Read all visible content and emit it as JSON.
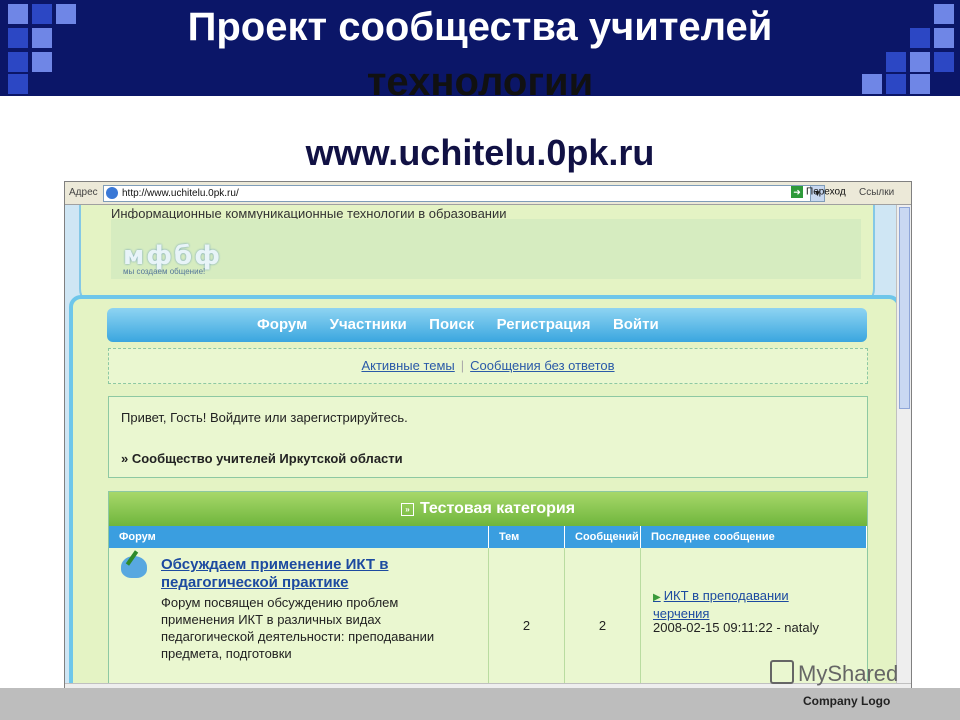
{
  "slide": {
    "title_line1": "Проект сообщества учителей",
    "title_line2": "технологии",
    "url": "www.uchitelu.0pk.ru"
  },
  "browser": {
    "address_label": "Адрес",
    "address_value": "http://www.uchitelu.0pk.ru/",
    "go_label": "Переход",
    "links_label": "Ссылки"
  },
  "site": {
    "slogan": "Информационные коммуникационные технологии в образовании",
    "logo_word": "мфбф",
    "logo_tagline": "мы создаем общение!",
    "nav": [
      "Форум",
      "Участники",
      "Поиск",
      "Регистрация",
      "Войти"
    ],
    "quick_links": [
      "Активные темы",
      "Сообщения без ответов"
    ],
    "greeting": "Привет, Гость!  Войдите или зарегистрируйтесь.",
    "community_link": "» Сообщество учителей Иркутской области",
    "category": "Тестовая категория",
    "columns": [
      "Форум",
      "Тем",
      "Сообщений",
      "Последнее сообщение"
    ],
    "forums": [
      {
        "title": "Обсуждаем применение ИКТ в педагогической практике",
        "description": "Форум посвящен обсуждению проблем применения ИКТ в различных видах педагогической деятельности: преподавании предмета, подготовки",
        "topics": "2",
        "posts": "2",
        "last_post_title": "ИКТ в преподавании черчения",
        "last_post_meta": "2008-02-15 09:11:22 - nataly"
      }
    ]
  },
  "footer": {
    "watermark": "MyShared",
    "company_logo": "Company   Logo"
  },
  "colors": {
    "header_band": "#0b1668",
    "nav_blue": "#3aa6df",
    "page_green": "#e4f3c4",
    "category_green": "#6fb53c"
  }
}
